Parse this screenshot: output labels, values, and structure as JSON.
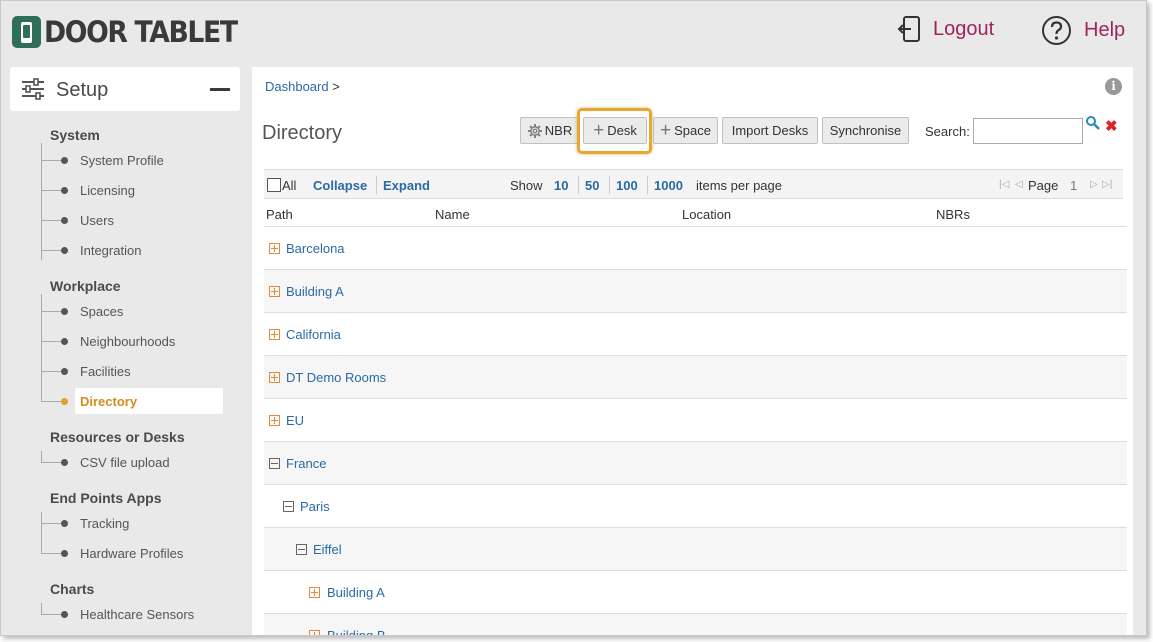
{
  "header": {
    "logo_text": "DOOR TABLET",
    "logout_label": "Logout",
    "help_label": "Help"
  },
  "sidebar": {
    "title": "Setup",
    "sections": [
      {
        "heading": "System",
        "items": [
          "System Profile",
          "Licensing",
          "Users",
          "Integration"
        ]
      },
      {
        "heading": "Workplace",
        "items": [
          "Spaces",
          "Neighbourhoods",
          "Facilities",
          "Directory"
        ]
      },
      {
        "heading": "Resources or Desks",
        "items": [
          "CSV file upload"
        ]
      },
      {
        "heading": "End Points Apps",
        "items": [
          "Tracking",
          "Hardware Profiles"
        ]
      },
      {
        "heading": "Charts",
        "items": [
          "Healthcare Sensors"
        ]
      }
    ],
    "active_item": "Directory"
  },
  "main": {
    "breadcrumb_link": "Dashboard",
    "breadcrumb_sep": ">",
    "title": "Directory",
    "toolbar": {
      "nbr": "NBR",
      "desk": "Desk",
      "space": "Space",
      "import_desks": "Import Desks",
      "synchronise": "Synchronise"
    },
    "search": {
      "label": "Search:",
      "value": ""
    },
    "grid": {
      "all_label": "All",
      "collapse": "Collapse",
      "expand": "Expand",
      "show_label": "Show",
      "page_sizes": [
        "10",
        "50",
        "100",
        "1000"
      ],
      "items_per_page": "items per page",
      "page_label": "Page",
      "page_number": "1"
    },
    "columns": [
      "Path",
      "Name",
      "Location",
      "NBRs"
    ],
    "rows": [
      {
        "label": "Barcelona",
        "level": 0,
        "state": "collapsed"
      },
      {
        "label": "Building A",
        "level": 0,
        "state": "collapsed"
      },
      {
        "label": "California",
        "level": 0,
        "state": "collapsed"
      },
      {
        "label": "DT Demo Rooms",
        "level": 0,
        "state": "collapsed"
      },
      {
        "label": "EU",
        "level": 0,
        "state": "collapsed"
      },
      {
        "label": "France",
        "level": 0,
        "state": "expanded"
      },
      {
        "label": "Paris",
        "level": 1,
        "state": "expanded"
      },
      {
        "label": "Eiffel",
        "level": 2,
        "state": "expanded"
      },
      {
        "label": "Building A",
        "level": 3,
        "state": "collapsed"
      },
      {
        "label": "Building B",
        "level": 3,
        "state": "collapsed"
      }
    ]
  },
  "colors": {
    "accent_link": "#2b6aa6",
    "header_link": "#a0245c",
    "active_nav": "#d28e1f",
    "highlight_border": "#e8a730",
    "logo_green": "#2f6f5a"
  }
}
